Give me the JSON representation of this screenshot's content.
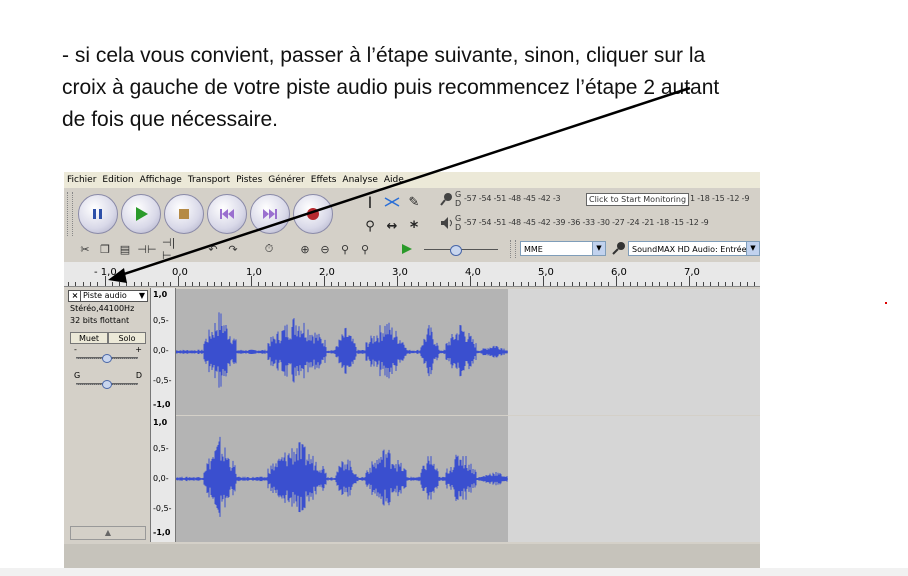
{
  "slide": {
    "lines": [
      "- si cela vous convient, passer à l’étape suivante, sinon, cliquer sur la",
      "croix à gauche de votre piste audio puis recommencez l’étape 2 autant",
      "de fois que nécessaire."
    ]
  },
  "app": {
    "menu": [
      "Fichier",
      "Edition",
      "Affichage",
      "Transport",
      "Pistes",
      "Générer",
      "Effets",
      "Analyse",
      "Aide"
    ],
    "meters": {
      "record_scale": "-57 -54 -51 -48 -45 -42 -3",
      "record_scale_tail": "1 -18 -15 -12 -9",
      "monitor_label": "Click to Start Monitoring",
      "play_scale": "-57 -54 -51 -48 -45 -42 -39 -36 -33 -30 -27 -24 -21 -18 -15 -12 -9",
      "channel_g": "G",
      "channel_d": "D"
    },
    "device": {
      "host": "MME",
      "input": "SoundMAX HD Audio: Entrée"
    },
    "ruler": {
      "labels": [
        "- 1,0",
        "0,0",
        "1,0",
        "2,0",
        "3,0",
        "4,0",
        "5,0",
        "6,0",
        "7,0"
      ]
    },
    "track": {
      "close": "×",
      "name": "Piste audio",
      "format": "Stéréo,44100Hz",
      "bits": "32 bits flottant",
      "mute": "Muet",
      "solo": "Solo",
      "gain_minus": "-",
      "gain_plus": "+",
      "pan_left": "G",
      "pan_right": "D",
      "scale": [
        "1,0",
        "0,5-",
        "0,0-",
        "-0,5-",
        "-1,0"
      ]
    }
  }
}
